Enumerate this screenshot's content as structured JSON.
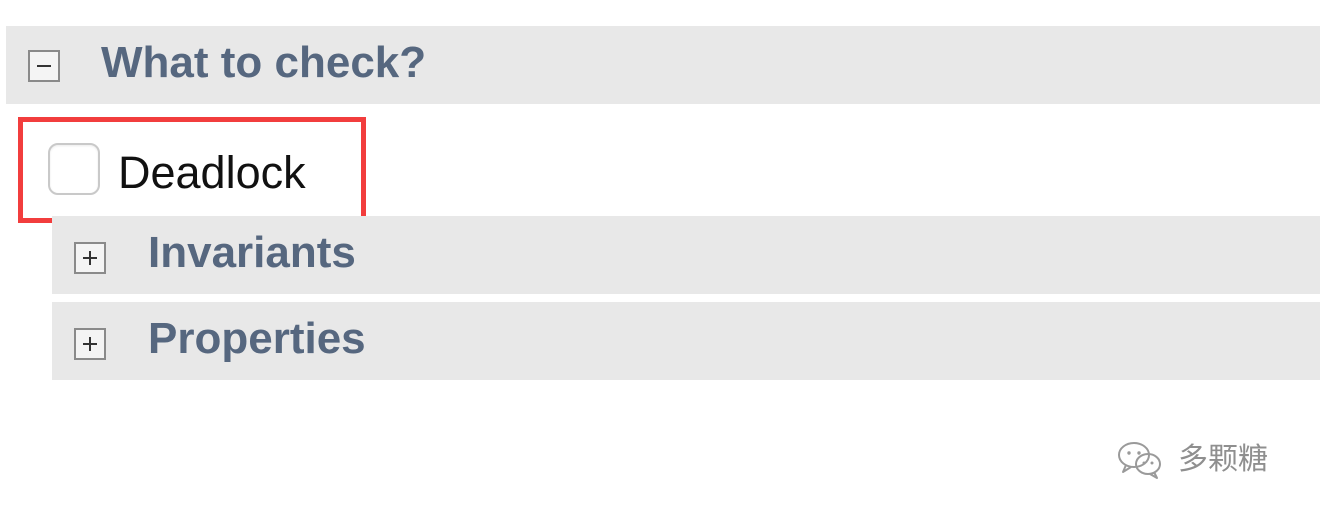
{
  "sections": {
    "what_to_check": {
      "title": "What to check?",
      "expanded": true,
      "toggle_icon": "minus-icon"
    },
    "invariants": {
      "title": "Invariants",
      "expanded": false,
      "toggle_icon": "plus-icon"
    },
    "properties": {
      "title": "Properties",
      "expanded": false,
      "toggle_icon": "plus-icon"
    }
  },
  "options": {
    "deadlock": {
      "label": "Deadlock",
      "checked": false
    }
  },
  "highlight": {
    "color": "#f23d3d"
  },
  "watermark": {
    "icon": "wechat-icon",
    "text": "多颗糖"
  },
  "colors": {
    "section_bar": "#e8e8e8",
    "section_title": "#56677f",
    "label_text": "#111111"
  }
}
